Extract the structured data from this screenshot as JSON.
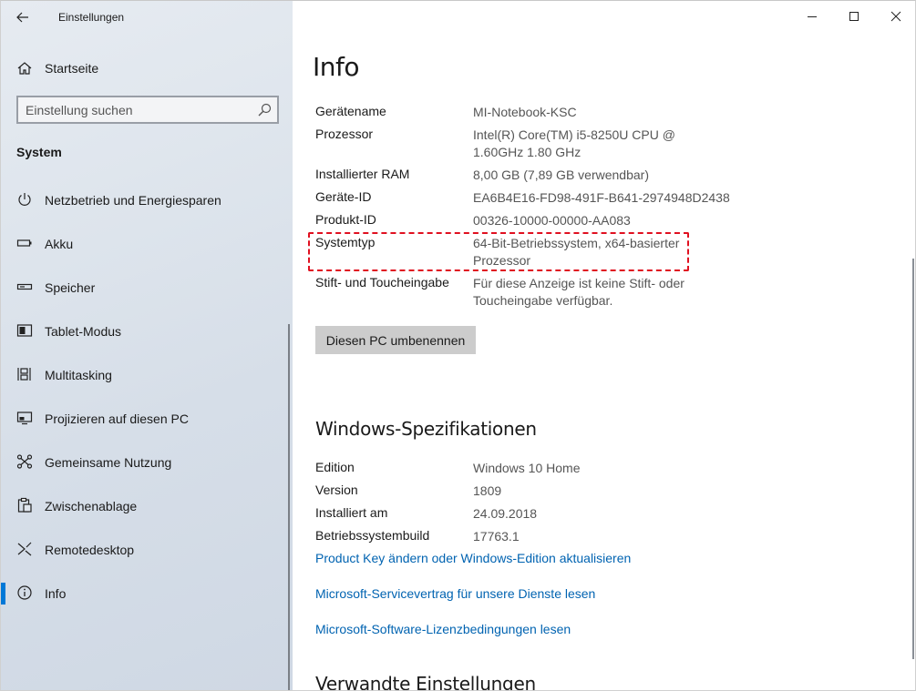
{
  "window": {
    "title": "Einstellungen"
  },
  "sidebar": {
    "home_label": "Startseite",
    "search_placeholder": "Einstellung suchen",
    "section_title": "System",
    "items": [
      {
        "label": "Netzbetrieb und Energiesparen",
        "icon": "power-icon"
      },
      {
        "label": "Akku",
        "icon": "battery-icon"
      },
      {
        "label": "Speicher",
        "icon": "storage-icon"
      },
      {
        "label": "Tablet-Modus",
        "icon": "tablet-mode-icon"
      },
      {
        "label": "Multitasking",
        "icon": "multitasking-icon"
      },
      {
        "label": "Projizieren auf diesen PC",
        "icon": "project-icon"
      },
      {
        "label": "Gemeinsame Nutzung",
        "icon": "share-icon"
      },
      {
        "label": "Zwischenablage",
        "icon": "clipboard-icon"
      },
      {
        "label": "Remotedesktop",
        "icon": "remote-desktop-icon"
      },
      {
        "label": "Info",
        "icon": "info-icon",
        "active": true
      }
    ]
  },
  "main": {
    "title": "Info",
    "device": [
      {
        "key": "Gerätename",
        "value": "MI-Notebook-KSC"
      },
      {
        "key": "Prozessor",
        "value": "Intel(R) Core(TM) i5-8250U CPU @ 1.60GHz 1.80 GHz"
      },
      {
        "key": "Installierter RAM",
        "value": "8,00 GB (7,89 GB verwendbar)"
      },
      {
        "key": "Geräte-ID",
        "value": "EA6B4E16-FD98-491F-B641-2974948D2438"
      },
      {
        "key": "Produkt-ID",
        "value": "00326-10000-00000-AA083"
      },
      {
        "key": "Systemtyp",
        "value": "64-Bit-Betriebssystem, x64-basierter Prozessor"
      },
      {
        "key": "Stift- und Toucheingabe",
        "value": "Für diese Anzeige ist keine Stift- oder Toucheingabe verfügbar."
      }
    ],
    "rename_button": "Diesen PC umbenennen",
    "specs_heading": "Windows-Spezifikationen",
    "specs": [
      {
        "key": "Edition",
        "value": "Windows 10 Home"
      },
      {
        "key": "Version",
        "value": "1809"
      },
      {
        "key": "Installiert am",
        "value": "24.09.2018"
      },
      {
        "key": "Betriebssystembuild",
        "value": "17763.1"
      }
    ],
    "links": [
      "Product Key ändern oder Windows-Edition aktualisieren",
      "Microsoft-Servicevertrag für unsere Dienste lesen",
      "Microsoft-Software-Lizenzbedingungen lesen"
    ],
    "related_heading": "Verwandte Einstellungen"
  },
  "colors": {
    "accent": "#0078d7",
    "link": "#0063b1",
    "highlight": "#e01020"
  }
}
